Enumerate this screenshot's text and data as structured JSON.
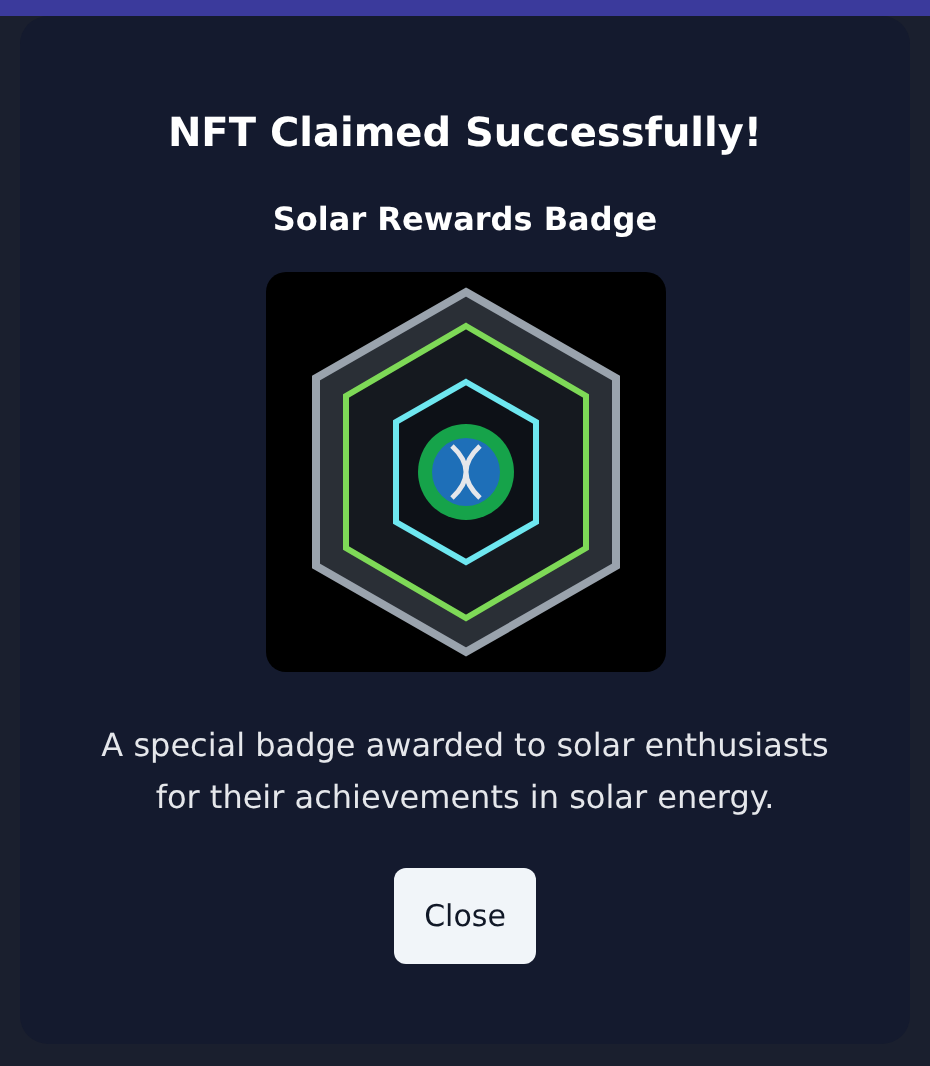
{
  "modal": {
    "title": "NFT Claimed Successfully!",
    "nft_name": "Solar Rewards Badge",
    "description": "A special badge awarded to solar enthusiasts for their achievements in solar energy.",
    "close_button": "Close"
  }
}
